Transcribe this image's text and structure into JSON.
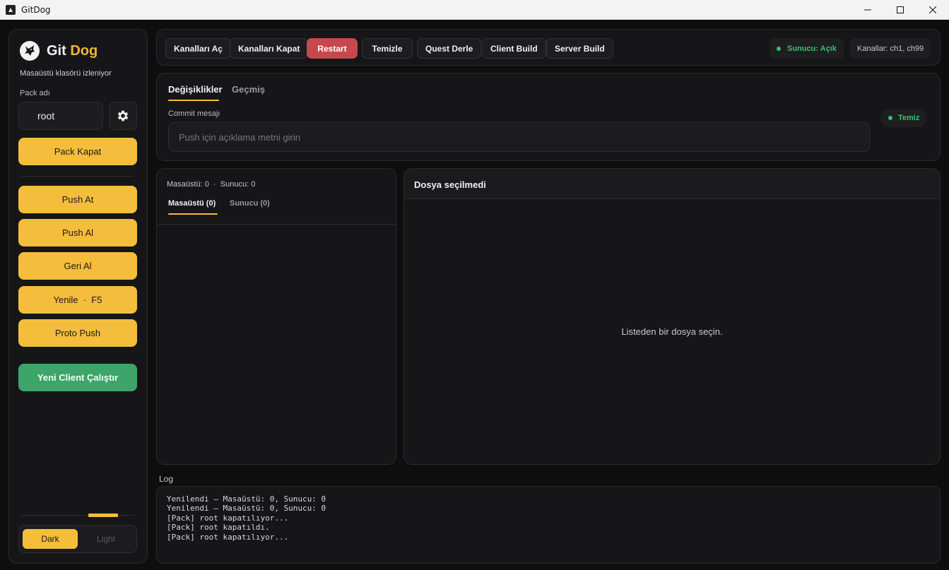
{
  "window": {
    "title": "GitDog"
  },
  "sidebar": {
    "logo_git": "Git",
    "logo_dog": "Dog",
    "subtitle": "Masaüstü klasörü izleniyor",
    "pack_label": "Pack adı",
    "pack_value": "root",
    "pack_close": "Pack Kapat",
    "actions": [
      "Push At",
      "Push Al",
      "Geri Al",
      "Yenile  ·  F5",
      "Proto Push"
    ],
    "new_client": "Yeni Client Çalıştır",
    "theme": {
      "dark": "Dark",
      "light": "Light",
      "selected": "Dark"
    }
  },
  "toolbar": {
    "buttons": [
      "Kanalları Aç",
      "Kanalları Kapat",
      "Restart",
      "Temizle",
      "Quest Derle",
      "Client Build",
      "Server Build"
    ],
    "server_status": "Sunucu: Açık",
    "channels": "Kanallar: ch1, ch99"
  },
  "commit": {
    "tabs": [
      "Değişiklikler",
      "Geçmiş"
    ],
    "active_tab": "Değişiklikler",
    "label": "Commit mesajı",
    "placeholder": "Push için açıklama metni girin",
    "value": "",
    "status": "Temiz"
  },
  "files": {
    "counts": "Masaüstü: 0  ·  Sunucu: 0",
    "tabs": [
      "Masaüstü (0)",
      "Sunucu (0)"
    ],
    "active_tab": "Masaüstü (0)"
  },
  "diff": {
    "title": "Dosya seçilmedi",
    "empty_message": "Listeden bir dosya seçin."
  },
  "log": {
    "label": "Log",
    "lines": [
      "Yenilendi — Masaüstü: 0, Sunucu: 0",
      "Yenilendi — Masaüstü: 0, Sunucu: 0",
      "[Pack] root kapatılıyor...",
      "[Pack] root kapatıldı.",
      "[Pack] root kapatılıyor..."
    ]
  },
  "colors": {
    "accent_yellow": "#f4bd3c",
    "danger_red": "#c6484d",
    "success_green": "#3ea56a",
    "status_green": "#3fbf6a"
  },
  "icons": [
    "app-icon",
    "minimize-icon",
    "maximize-icon",
    "close-icon",
    "gitdog-logo-icon",
    "gear-icon",
    "status-dot-icon"
  ]
}
